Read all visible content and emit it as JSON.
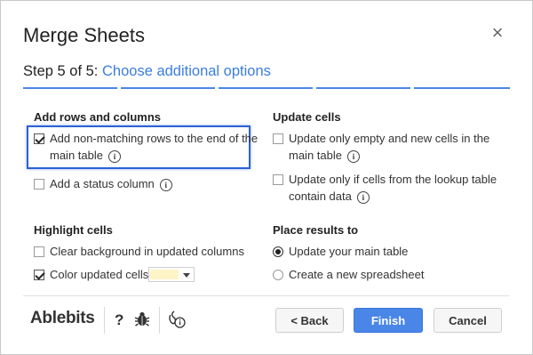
{
  "dialog": {
    "title": "Merge Sheets",
    "close_icon": "×"
  },
  "step": {
    "prefix": "Step 5 of 5:",
    "label": "Choose additional options",
    "total": 5,
    "current": 5
  },
  "add_rows": {
    "title": "Add rows and columns",
    "non_matching_line1": "Add non-matching rows to the end of the",
    "non_matching_line2": "main table",
    "non_matching_checked": true,
    "status_column": "Add a status column",
    "status_column_checked": false
  },
  "update_cells": {
    "title": "Update cells",
    "empty_line1": "Update only empty and new cells in the",
    "empty_line2": "main table",
    "empty_checked": false,
    "lookup_line1": "Update only if cells from the lookup table",
    "lookup_line2": "contain data",
    "lookup_checked": false
  },
  "highlight": {
    "title": "Highlight cells",
    "clear_bg": "Clear background in updated columns",
    "clear_bg_checked": false,
    "color_cells": "Color updated cells",
    "color_cells_checked": true,
    "color_value": "#fff4c7"
  },
  "place_results": {
    "title": "Place results to",
    "option_main": "Update your main table",
    "option_new": "Create a new spreadsheet",
    "selected": "main"
  },
  "footer": {
    "brand": "Ablebits",
    "help_icon": "?",
    "bug_icon": "bug-icon",
    "privacy_icon": "privacy-info-icon",
    "back_label": "< Back",
    "finish_label": "Finish",
    "cancel_label": "Cancel"
  },
  "info_glyph": "i",
  "colors": {
    "accent": "#4a86e8",
    "highlight_border": "#2c62d6"
  }
}
